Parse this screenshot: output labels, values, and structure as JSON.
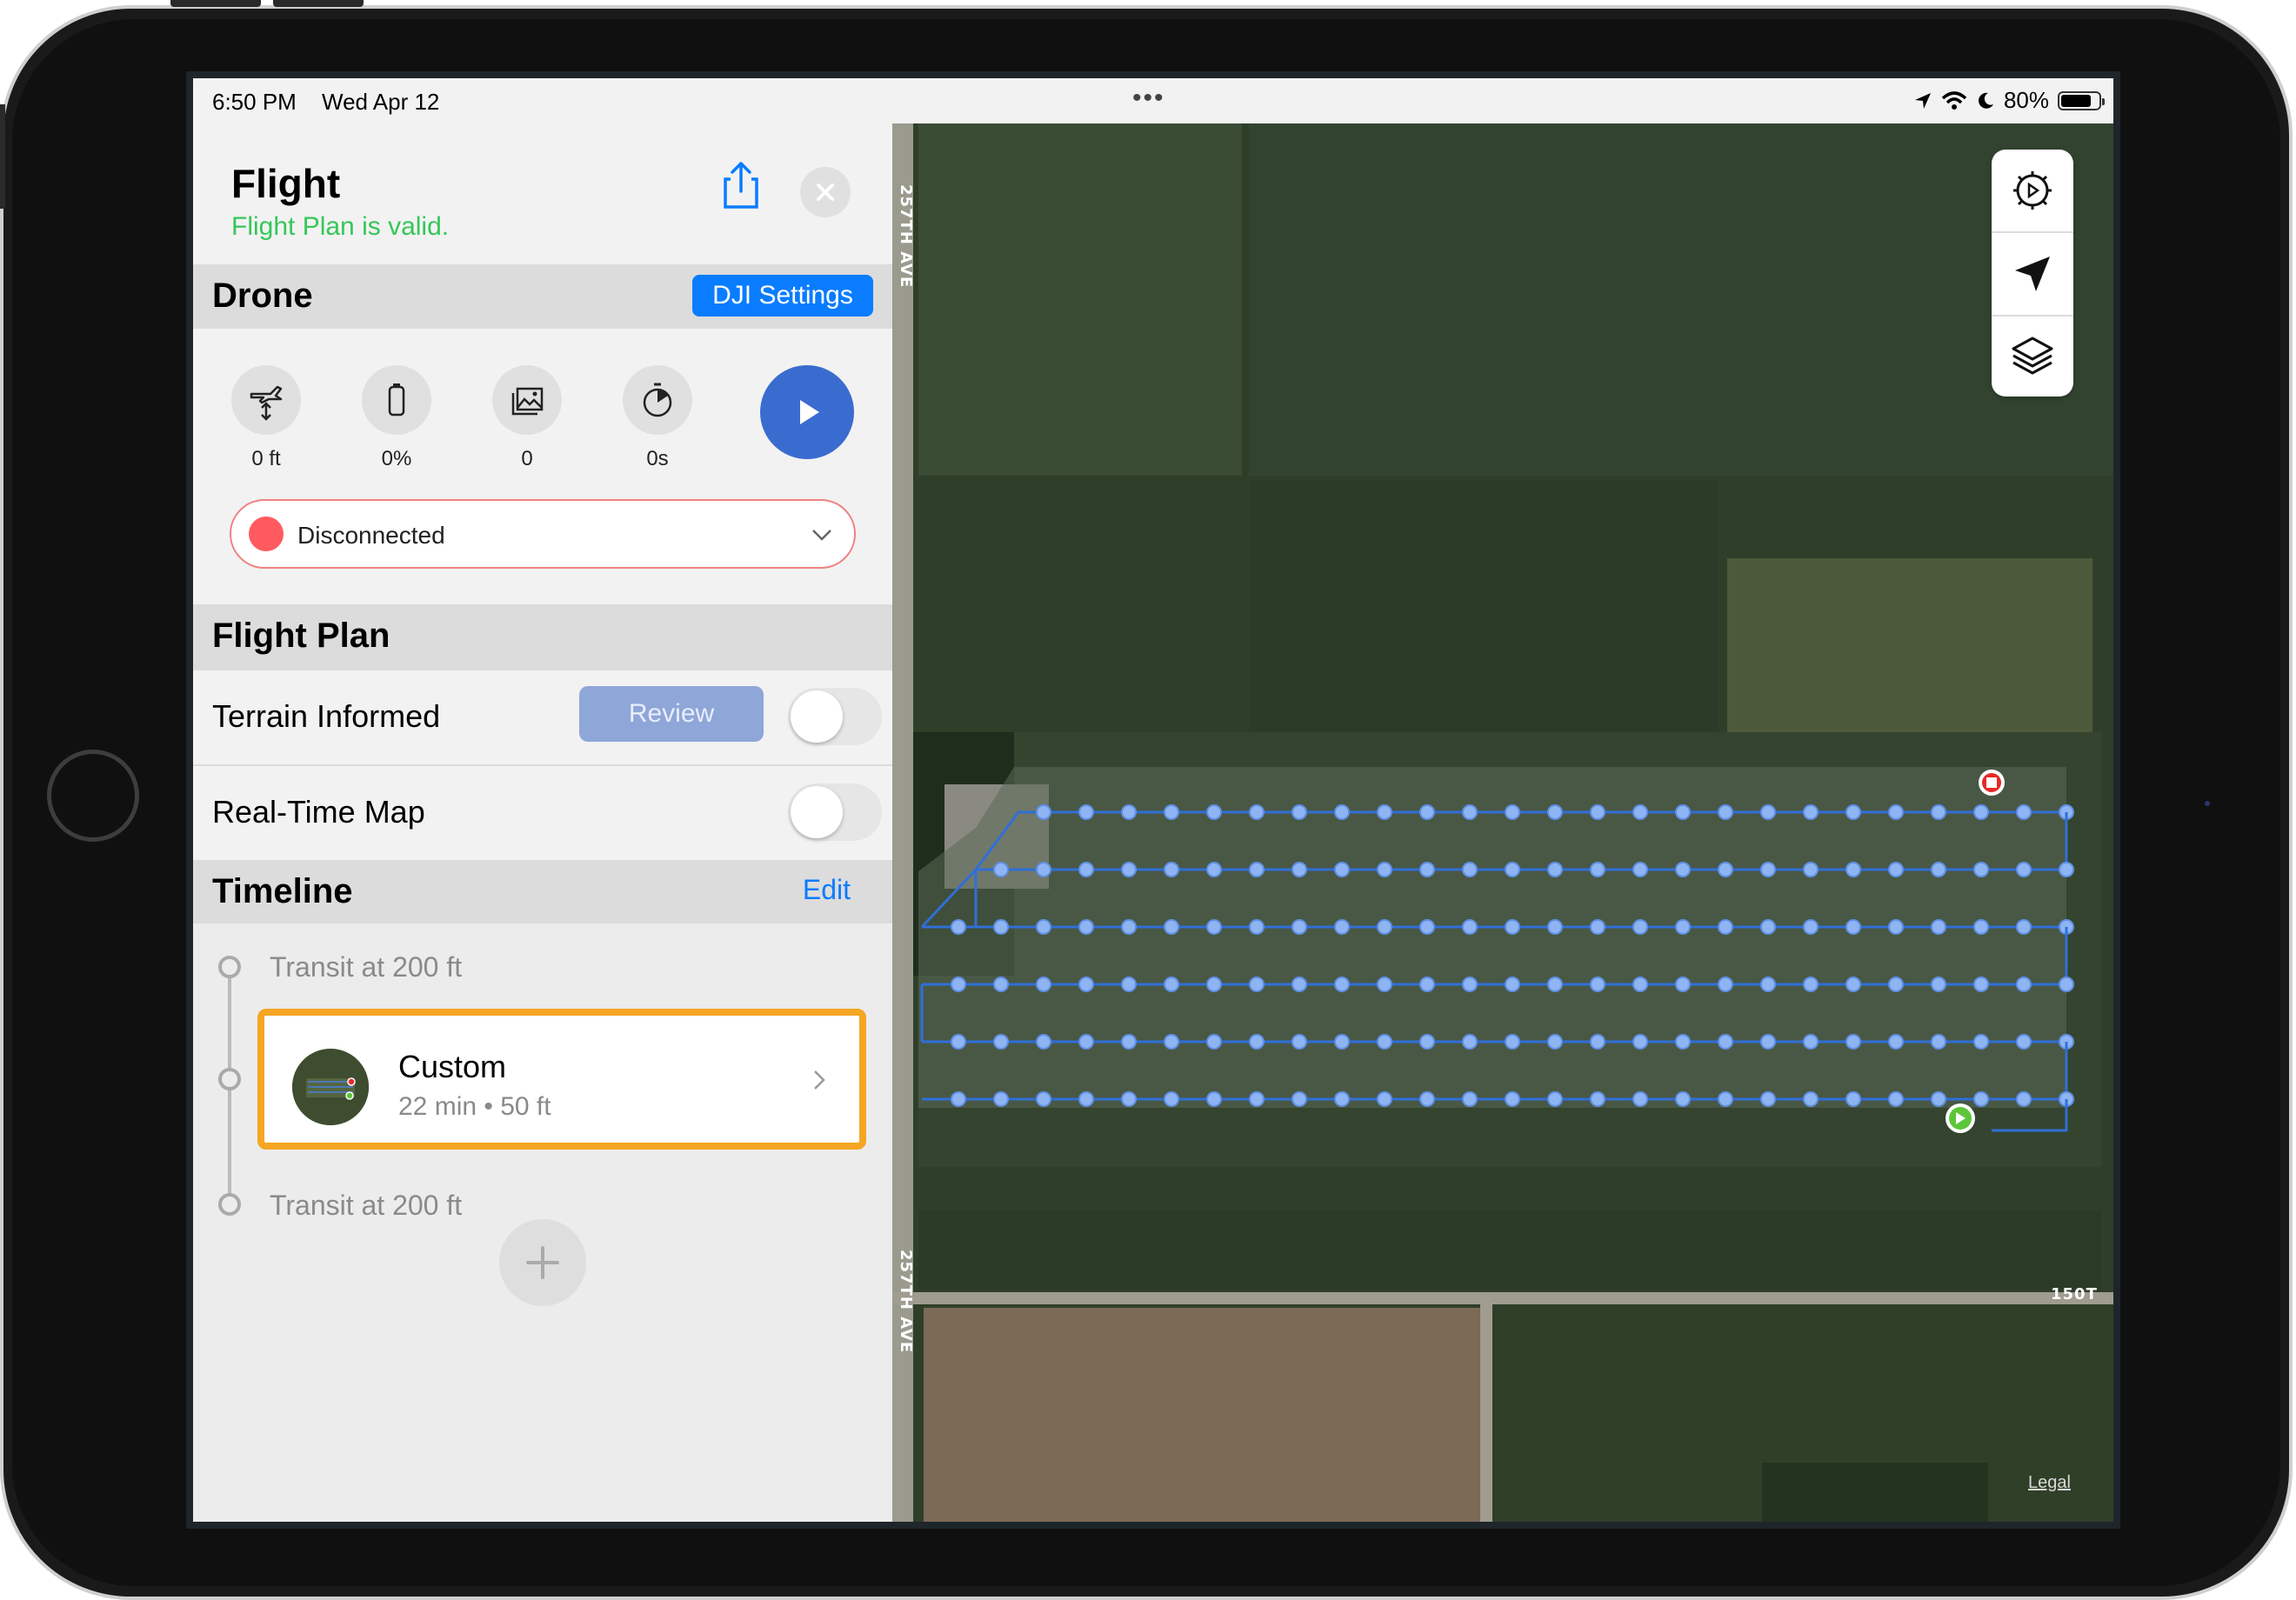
{
  "status_bar": {
    "time": "6:50 PM",
    "date": "Wed Apr 12",
    "multitask_dots": "•••",
    "battery_percent": "80%",
    "battery_level": 0.8
  },
  "flight_panel": {
    "title": "Flight",
    "validity": "Flight Plan is valid.",
    "share_icon": "share-icon",
    "close_icon": "close-icon"
  },
  "drone": {
    "section_title": "Drone",
    "settings_button": "DJI Settings",
    "stats": [
      {
        "icon": "altitude-icon",
        "value": "0 ft"
      },
      {
        "icon": "battery-icon",
        "value": "0%"
      },
      {
        "icon": "photos-icon",
        "value": "0"
      },
      {
        "icon": "timer-icon",
        "value": "0s"
      }
    ],
    "play_icon": "play-icon",
    "connection": {
      "status": "Disconnected",
      "dot_color": "#ff5a5f"
    }
  },
  "flight_plan": {
    "section_title": "Flight Plan",
    "terrain_label": "Terrain Informed",
    "review_button": "Review",
    "terrain_on": false,
    "realtime_label": "Real-Time Map",
    "realtime_on": false
  },
  "timeline": {
    "section_title": "Timeline",
    "edit_link": "Edit",
    "transit_before": "Transit at 200 ft",
    "mission": {
      "name": "Custom",
      "meta": "22 min • 50 ft"
    },
    "transit_after": "Transit at 200 ft",
    "add_icon": "plus-icon"
  },
  "map": {
    "tools": [
      "settings-icon",
      "location-arrow-icon",
      "layers-icon"
    ],
    "road_labels": {
      "west_road": "257TH AVE",
      "west_road_lower": "257TH AVE",
      "south_road": "150T"
    },
    "legal": "Legal",
    "accent": "#2f6fd8",
    "start_color": "#5cc63a",
    "end_color": "#e62828"
  }
}
